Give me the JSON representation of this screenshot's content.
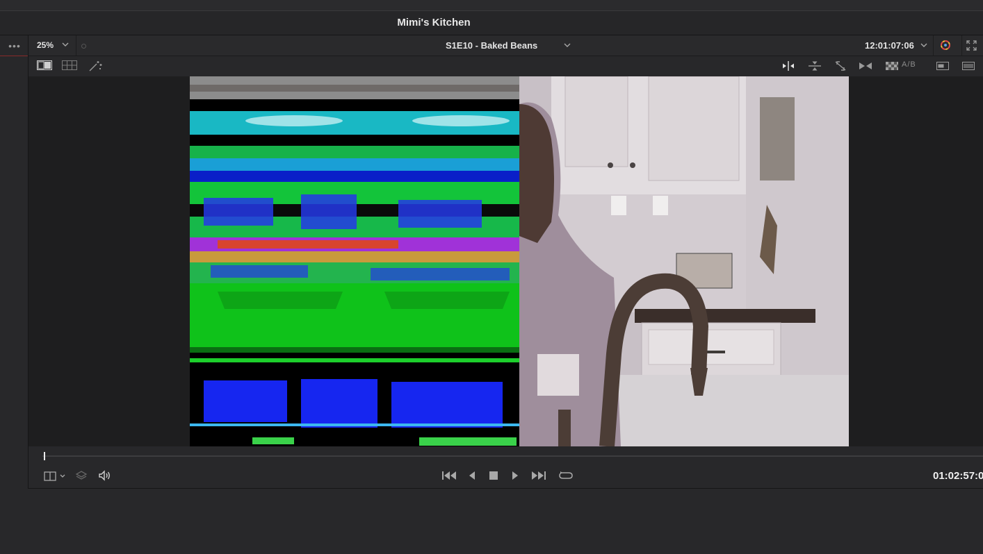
{
  "app": {
    "title": "Mimi's Kitchen"
  },
  "toolbar": {
    "zoom": "25%",
    "clip_name": "S1E10 - Baked Beans",
    "timecode": "12:01:07:06",
    "ab_label": "A/B"
  },
  "transport": {
    "timecode": "01:02:57:0"
  },
  "icons": {
    "options": "more-options-icon",
    "single_viewer": "single-viewer-icon",
    "grid_viewer": "multi-viewer-icon",
    "magic": "magic-wand-icon",
    "wipe_horizontal": "horizontal-wipe-icon",
    "wipe_vertical": "vertical-wipe-icon",
    "wipe_diagonal": "diagonal-wipe-icon",
    "wipe_center": "center-wipe-icon",
    "checker": "checkerboard-icon",
    "overlay": "overlay-icon",
    "list": "list-icon",
    "color": "color-wheel-icon",
    "fullscreen": "fullscreen-icon",
    "layers": "layers-icon",
    "volume": "volume-icon",
    "skip_start": "skip-to-start-icon",
    "step_back": "step-back-icon",
    "stop": "stop-icon",
    "play": "play-icon",
    "skip_end": "skip-to-end-icon",
    "loop": "loop-icon"
  },
  "colors": {
    "panel": "#28282a",
    "viewer_bg": "#1e1e1f",
    "accent_red": "#8a2b2b"
  }
}
